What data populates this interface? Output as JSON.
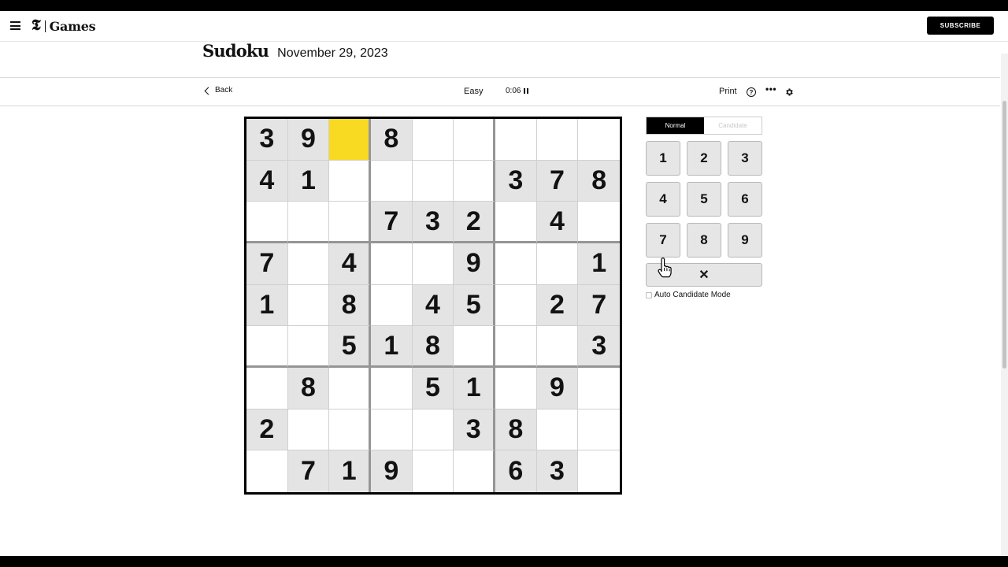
{
  "nav": {
    "logo_mark": "𝕿",
    "logo_text": "Games",
    "subscribe_label": "SUBSCRIBE"
  },
  "header": {
    "title": "Sudoku",
    "date": "November 29, 2023"
  },
  "toolbar": {
    "back_label": "Back",
    "difficulty": "Easy",
    "timer": "0:06",
    "print_label": "Print",
    "help_glyph": "?",
    "more_glyph": "•••"
  },
  "board": {
    "selected_cell": {
      "row": 0,
      "col": 2
    },
    "selected_color": "#f7da21",
    "given_color": "#e4e4e4",
    "rows": [
      [
        "3",
        "9",
        "",
        "8",
        "",
        "",
        "",
        "",
        ""
      ],
      [
        "4",
        "1",
        "",
        "",
        "",
        "",
        "3",
        "7",
        "8"
      ],
      [
        "",
        "",
        "",
        "7",
        "3",
        "2",
        "",
        "4",
        ""
      ],
      [
        "7",
        "",
        "4",
        "",
        "",
        "9",
        "",
        "",
        "1"
      ],
      [
        "1",
        "",
        "8",
        "",
        "4",
        "5",
        "",
        "2",
        "7"
      ],
      [
        "",
        "",
        "5",
        "1",
        "8",
        "",
        "",
        "",
        "3"
      ],
      [
        "",
        "8",
        "",
        "",
        "5",
        "1",
        "",
        "9",
        ""
      ],
      [
        "2",
        "",
        "",
        "",
        "",
        "3",
        "8",
        "",
        ""
      ],
      [
        "",
        "7",
        "1",
        "9",
        "",
        "",
        "6",
        "3",
        ""
      ]
    ]
  },
  "panel": {
    "mode_normal": "Normal",
    "mode_candidate": "Candidate",
    "active_mode": "Normal",
    "numbers": [
      "1",
      "2",
      "3",
      "4",
      "5",
      "6",
      "7",
      "8",
      "9"
    ],
    "erase_glyph": "✕",
    "auto_candidate_label": "Auto Candidate Mode",
    "auto_candidate_checked": false
  },
  "icons": {
    "menu": "hamburger-icon",
    "back": "chevron-left-icon",
    "pause": "pause-icon",
    "help": "help-icon",
    "more": "more-icon",
    "settings": "gear-icon",
    "pointer": "hand-pointer-icon"
  }
}
